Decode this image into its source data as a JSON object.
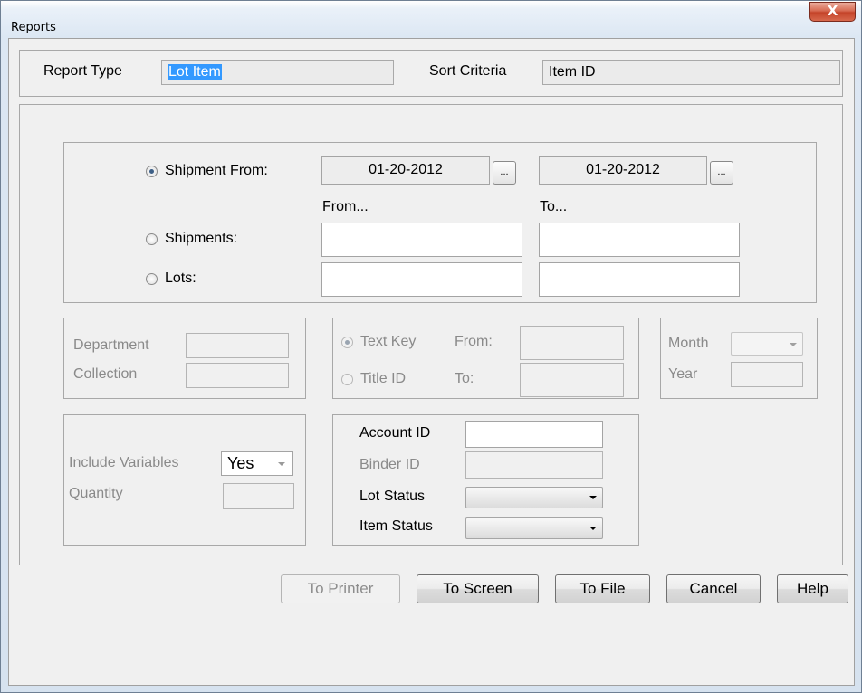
{
  "window": {
    "title": "Reports",
    "close_label": "X"
  },
  "header": {
    "report_type_label": "Report Type",
    "report_type_value": "Lot Item",
    "sort_criteria_label": "Sort Criteria",
    "sort_criteria_value": "Item ID"
  },
  "shipment": {
    "shipment_from_label": "Shipment From:",
    "from_date": "01-20-2012",
    "to_date": "01-20-2012",
    "date_button": "...",
    "from_caption": "From...",
    "to_caption": "To...",
    "shipments_label": "Shipments:",
    "lots_label": "Lots:"
  },
  "dept": {
    "department_label": "Department",
    "collection_label": "Collection"
  },
  "textkey": {
    "text_key_label": "Text Key",
    "title_id_label": "Title ID",
    "from_label": "From:",
    "to_label": "To:"
  },
  "period": {
    "month_label": "Month",
    "year_label": "Year"
  },
  "variables": {
    "include_label": "Include Variables",
    "include_value": "Yes",
    "quantity_label": "Quantity"
  },
  "account": {
    "account_id_label": "Account ID",
    "binder_id_label": "Binder ID",
    "lot_status_label": "Lot Status",
    "item_status_label": "Item Status"
  },
  "buttons": {
    "to_printer": "To Printer",
    "to_screen": "To Screen",
    "to_file": "To File",
    "cancel": "Cancel",
    "help": "Help"
  }
}
